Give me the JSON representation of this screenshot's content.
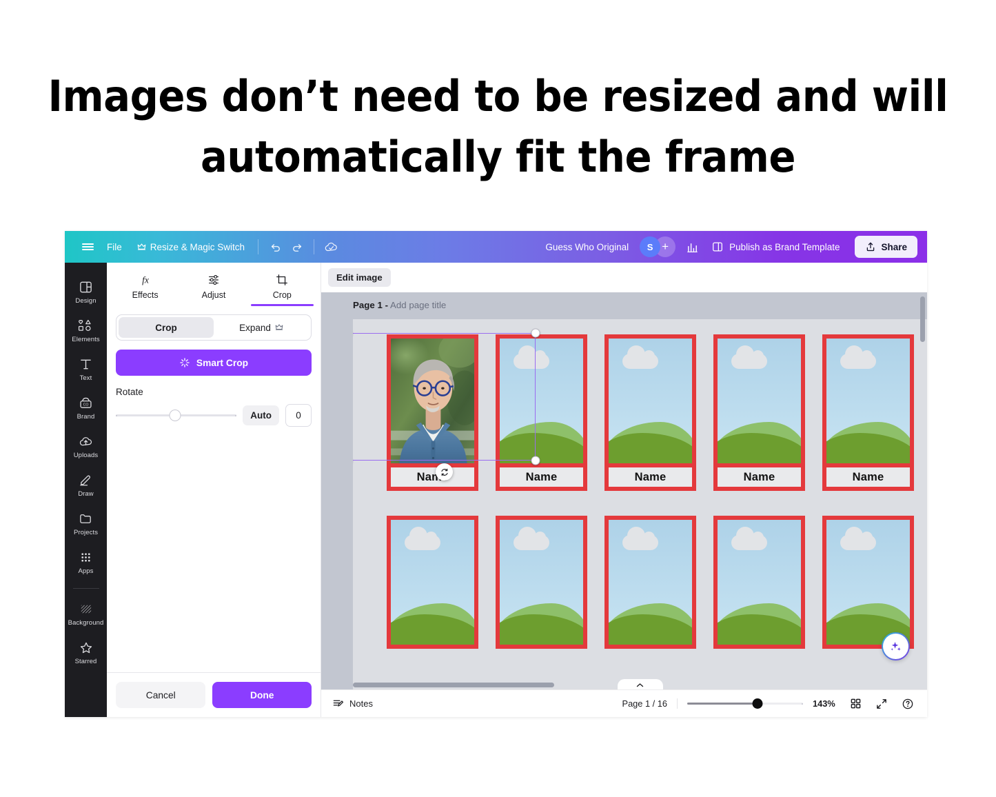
{
  "headline": {
    "line1": "Images don’t need to be resized and will",
    "line2": "automatically fit the frame"
  },
  "topbar": {
    "menu_icon": "hamburger-icon",
    "file_label": "File",
    "resize_label": "Resize & Magic Switch",
    "resize_crown_icon": "crown-icon",
    "undo_icon": "undo-icon",
    "redo_icon": "redo-icon",
    "cloud_icon": "cloud-saved-icon",
    "doc_title": "Guess Who Original",
    "avatar_initial": "S",
    "add_collaborator": "+",
    "insights_icon": "insights-bar-chart-icon",
    "publish_icon": "brand-template-icon",
    "publish_label": "Publish as Brand Template",
    "share_icon": "share-upload-icon",
    "share_label": "Share",
    "accent_purple": "#8b3dff",
    "avatar_color": "#5b7cfa"
  },
  "rail": {
    "items": [
      {
        "label": "Design",
        "icon": "design-panel-icon"
      },
      {
        "label": "Elements",
        "icon": "elements-shapes-icon"
      },
      {
        "label": "Text",
        "icon": "text-t-icon"
      },
      {
        "label": "Brand",
        "icon": "brand-kit-icon"
      },
      {
        "label": "Uploads",
        "icon": "uploads-cloud-icon"
      },
      {
        "label": "Draw",
        "icon": "draw-pen-icon"
      },
      {
        "label": "Projects",
        "icon": "projects-folder-icon"
      },
      {
        "label": "Apps",
        "icon": "apps-grid-icon"
      }
    ],
    "items_below_divider": [
      {
        "label": "Background",
        "icon": "background-hatch-icon"
      },
      {
        "label": "Starred",
        "icon": "starred-star-icon"
      }
    ]
  },
  "panel": {
    "tabs": [
      {
        "label": "Effects",
        "icon": "effects-fx-icon",
        "active": false
      },
      {
        "label": "Adjust",
        "icon": "adjust-sliders-icon",
        "active": false
      },
      {
        "label": "Crop",
        "icon": "crop-frame-icon",
        "active": true
      }
    ],
    "segment": {
      "crop_label": "Crop",
      "expand_label": "Expand",
      "expand_crown_icon": "crown-icon",
      "selected": "Crop"
    },
    "smart_crop_label": "Smart Crop",
    "smart_crop_icon": "magic-sparkle-icon",
    "rotate_label": "Rotate",
    "rotate_auto_label": "Auto",
    "rotate_value": "0",
    "cancel_label": "Cancel",
    "done_label": "Done"
  },
  "canvas": {
    "edit_image_label": "Edit image",
    "page_label": "Page 1 -",
    "page_title_placeholder": "Add page title",
    "card_name": "Name",
    "row1": [
      {
        "type": "photo",
        "name": "Name"
      },
      {
        "type": "placeholder",
        "name": "Name"
      },
      {
        "type": "placeholder",
        "name": "Name"
      },
      {
        "type": "placeholder",
        "name": "Name"
      },
      {
        "type": "placeholder",
        "name": "Name"
      }
    ],
    "row2": [
      {
        "type": "placeholder",
        "name": ""
      },
      {
        "type": "placeholder",
        "name": ""
      },
      {
        "type": "placeholder",
        "name": ""
      },
      {
        "type": "placeholder",
        "name": ""
      },
      {
        "type": "placeholder",
        "name": ""
      }
    ],
    "frame_color": "#e4393c",
    "selection_color": "#9a6cf0",
    "rotate_handle_icon": "rotate-handle-icon",
    "ai_fab_icon": "magic-ai-sparkle-icon"
  },
  "bottombar": {
    "notes_icon": "notes-icon",
    "notes_label": "Notes",
    "page_indicator": "Page 1 / 16",
    "zoom_percent": "143%",
    "grid_icon": "grid-view-icon",
    "fullscreen_icon": "fullscreen-expand-icon",
    "help_icon": "help-question-icon"
  }
}
